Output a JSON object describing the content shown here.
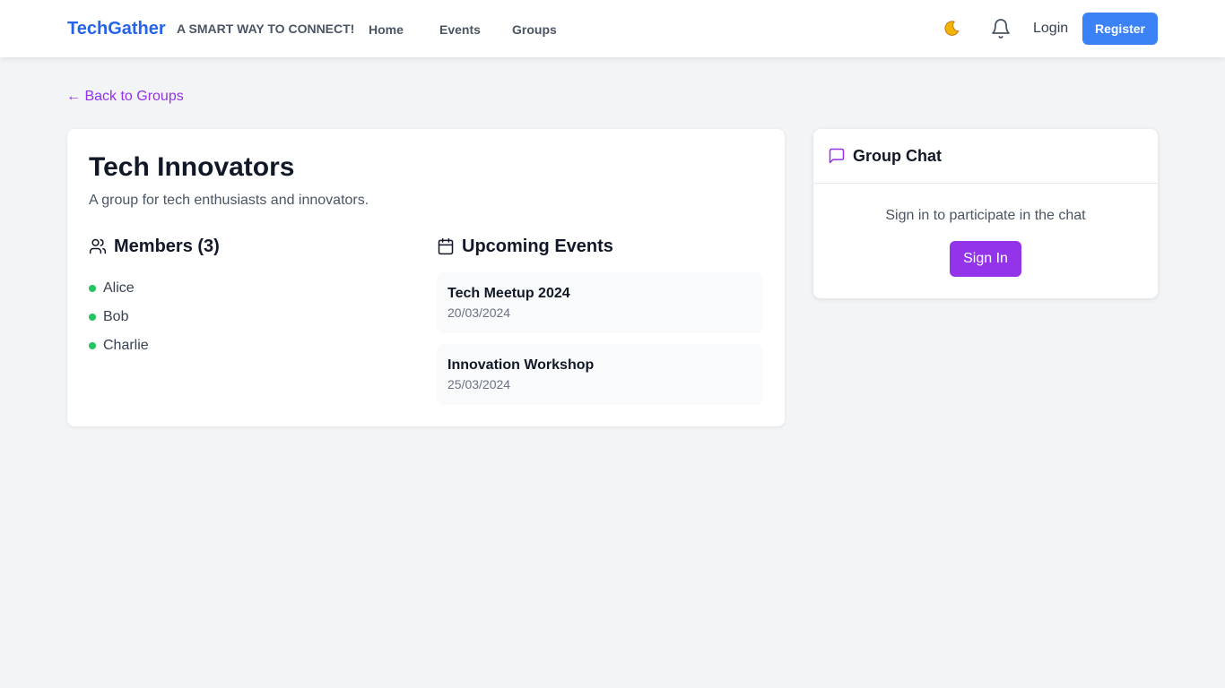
{
  "navbar": {
    "brand": "TechGather",
    "tagline": "A SMART WAY TO CONNECT!",
    "links": [
      {
        "label": "Home"
      },
      {
        "label": "Events"
      },
      {
        "label": "Groups"
      }
    ],
    "theme_icon": "moon-icon",
    "notification_icon": "bell-icon",
    "login_label": "Login",
    "register_label": "Register"
  },
  "back_link": "← Back to Groups",
  "group": {
    "name": "Tech Innovators",
    "description": "A group for tech enthusiasts and innovators.",
    "members_heading": "Members (3)",
    "members": [
      "Alice",
      "Bob",
      "Charlie"
    ],
    "events_heading": "Upcoming Events",
    "events": [
      {
        "name": "Tech Meetup 2024",
        "date": "20/03/2024"
      },
      {
        "name": "Innovation Workshop",
        "date": "25/03/2024"
      }
    ]
  },
  "chat": {
    "title": "Group Chat",
    "prompt": "Sign in to participate in the chat",
    "signin_label": "Sign In"
  },
  "colors": {
    "brand": "#2563eb",
    "accent_purple": "#9333ea",
    "register_blue": "#3b82f6",
    "member_online": "#22c55e",
    "page_bg": "#f3f4f6"
  }
}
